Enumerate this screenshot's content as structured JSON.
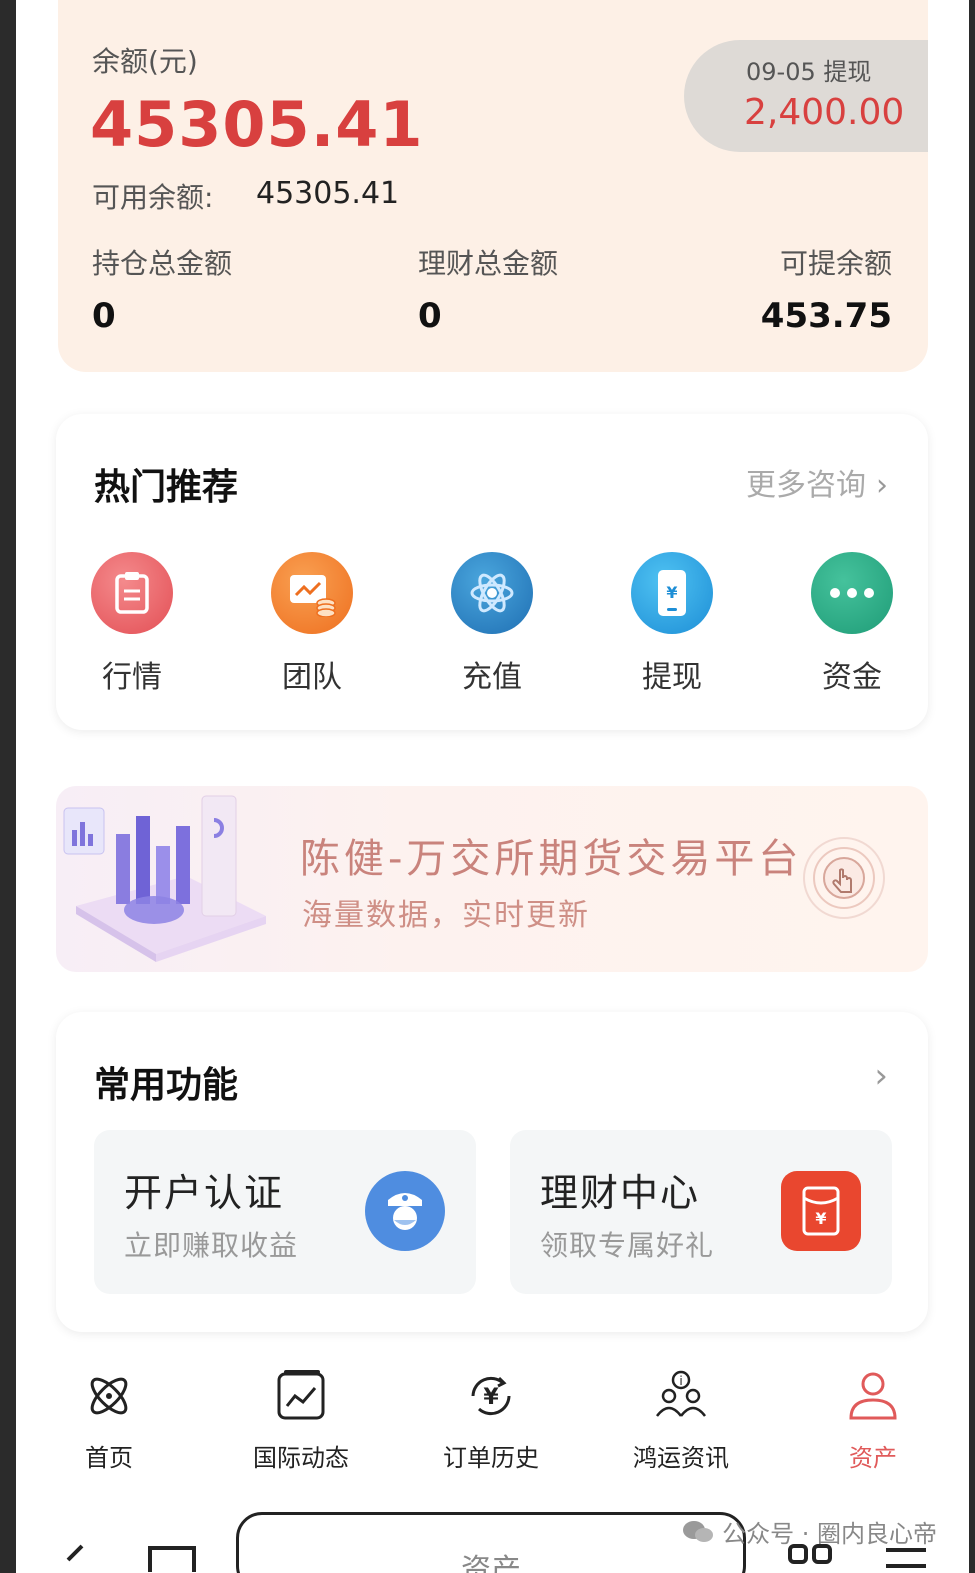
{
  "balance": {
    "label": "余额(元)",
    "amount": "45305.41",
    "available_label": "可用余额:",
    "available_value": "45305.41",
    "withdraw_date": "09-05 提现",
    "withdraw_amount": "2,400.00",
    "stats": [
      {
        "label": "持仓总金额",
        "value": "0"
      },
      {
        "label": "理财总金额",
        "value": "0"
      },
      {
        "label": "可提余额",
        "value": "453.75"
      }
    ]
  },
  "hot": {
    "title": "热门推荐",
    "more_label": "更多咨询",
    "items": [
      {
        "label": "行情",
        "icon": "clipboard-icon",
        "color": "#e8575b"
      },
      {
        "label": "团队",
        "icon": "chart-coins-icon",
        "color": "#f07a2a"
      },
      {
        "label": "充值",
        "icon": "atom-icon",
        "color": "#2f86c8"
      },
      {
        "label": "提现",
        "icon": "phone-yen-icon",
        "color": "#2a9be0"
      },
      {
        "label": "资金",
        "icon": "more-dots-icon",
        "color": "#27a684"
      }
    ]
  },
  "banner": {
    "title": "陈健-万交所期货交易平台",
    "subtitle": "海量数据，实时更新"
  },
  "functions": {
    "title": "常用功能",
    "items": [
      {
        "title": "开户认证",
        "subtitle": "立即赚取收益",
        "icon": "officer-icon",
        "color": "#4f8de0"
      },
      {
        "title": "理财中心",
        "subtitle": "领取专属好礼",
        "icon": "red-envelope-icon",
        "color": "#e9472f"
      }
    ]
  },
  "nav": {
    "items": [
      {
        "label": "首页",
        "icon": "atom-outline-icon"
      },
      {
        "label": "国际动态",
        "icon": "chart-window-icon"
      },
      {
        "label": "订单历史",
        "icon": "yen-refresh-icon"
      },
      {
        "label": "鸿运资讯",
        "icon": "team-info-icon"
      },
      {
        "label": "资产",
        "icon": "user-icon",
        "active": true
      }
    ]
  },
  "system_bar": {
    "url_text": "资产",
    "watermark": "公众号 · 圈内良心帝"
  }
}
